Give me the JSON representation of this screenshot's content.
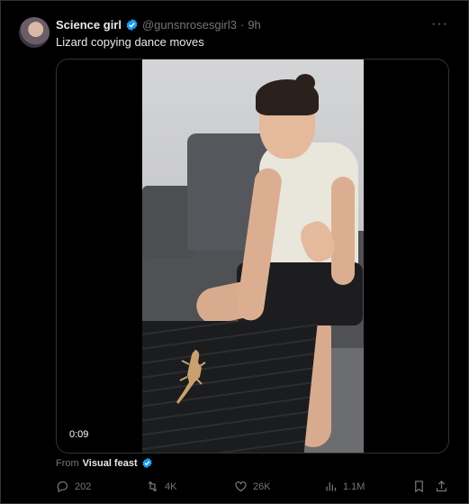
{
  "tweet": {
    "author_name": "Science girl",
    "handle": "@gunsnrosesgirl3",
    "separator": "·",
    "time": "9h",
    "more": "···",
    "text": "Lizard copying dance moves",
    "video_timestamp": "0:09",
    "from_prefix": "From",
    "from_source": "Visual feast"
  },
  "actions": {
    "replies": "202",
    "reposts": "4K",
    "likes": "26K",
    "views": "1.1M"
  },
  "colors": {
    "background": "#000000",
    "text_primary": "#e7e9ea",
    "text_secondary": "#71767b",
    "verified": "#1d9bf0",
    "border": "#2f3336"
  },
  "icons": [
    "verified-badge-icon",
    "more-icon",
    "reply-icon",
    "repost-icon",
    "like-icon",
    "views-icon",
    "bookmark-icon",
    "share-icon"
  ]
}
